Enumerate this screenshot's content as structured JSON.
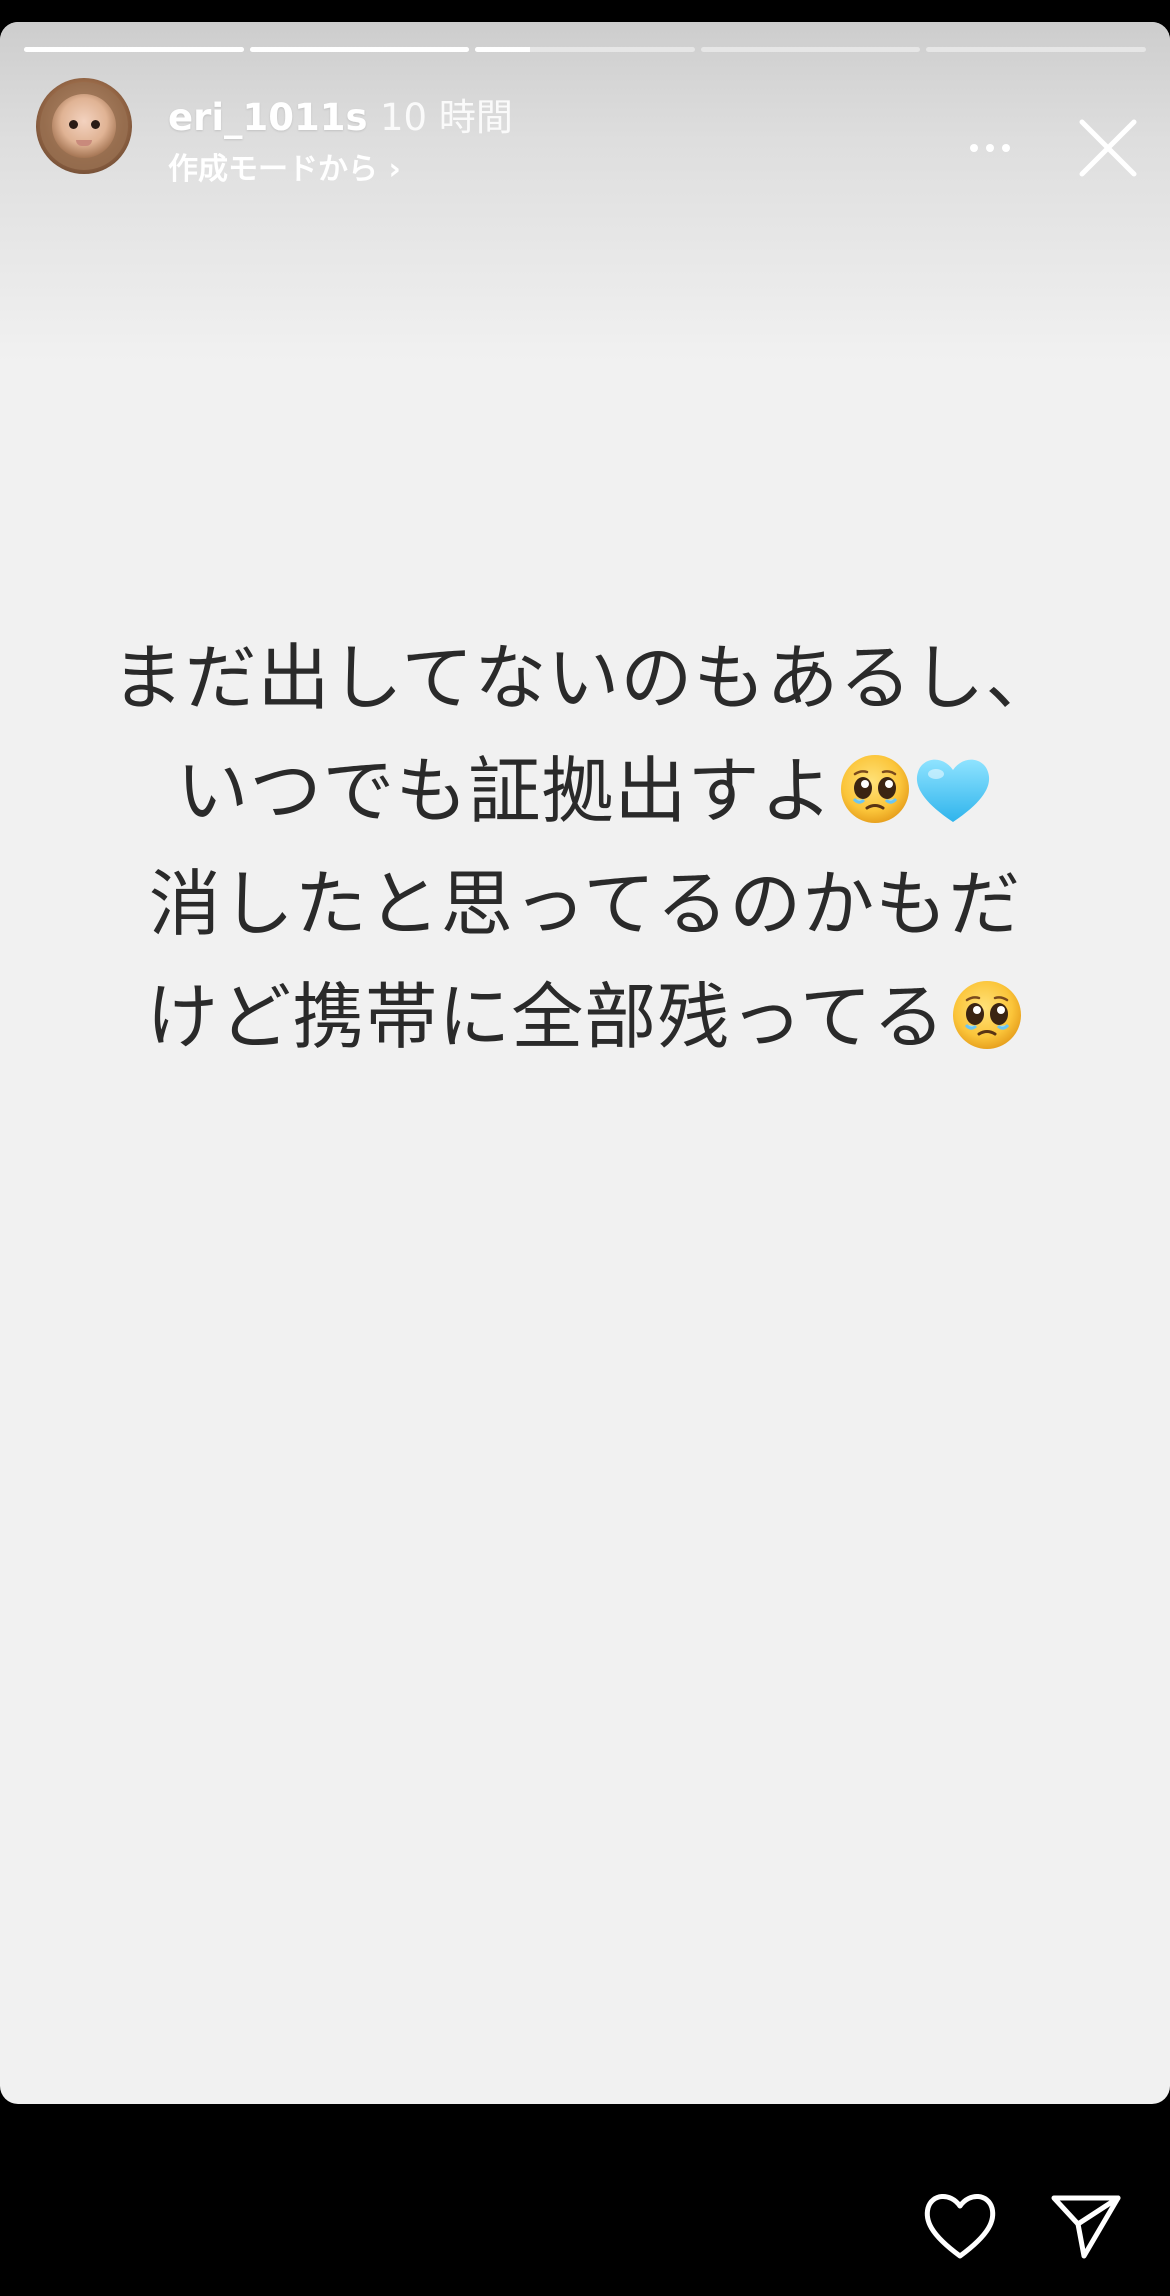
{
  "story": {
    "segments": [
      {
        "progress": 1.0
      },
      {
        "progress": 1.0
      },
      {
        "progress": 0.25
      },
      {
        "progress": 0.0
      },
      {
        "progress": 0.0
      }
    ],
    "background_color": "#f1f1f1"
  },
  "header": {
    "username": "eri_1011s",
    "timestamp": "10 時間",
    "subtitle": "作成モードから ›",
    "avatar_icon": "baby-profile-photo",
    "more_icon": "more-horizontal-icon",
    "close_icon": "close-icon"
  },
  "content": {
    "lines": [
      {
        "text": "まだ出してないのもあるし、",
        "emoji": []
      },
      {
        "text": "いつでも証拠出すよ",
        "emoji": [
          "pleading-face-emoji",
          "light-blue-heart-emoji"
        ]
      },
      {
        "text": "消したと思ってるのかもだ",
        "emoji": []
      },
      {
        "text": "けど携帯に全部残ってる",
        "emoji": [
          "pleading-face-emoji"
        ]
      }
    ],
    "text_color": "#2a2a2a"
  },
  "footer": {
    "like_icon": "heart-outline-icon",
    "send_icon": "send-paper-plane-icon"
  }
}
